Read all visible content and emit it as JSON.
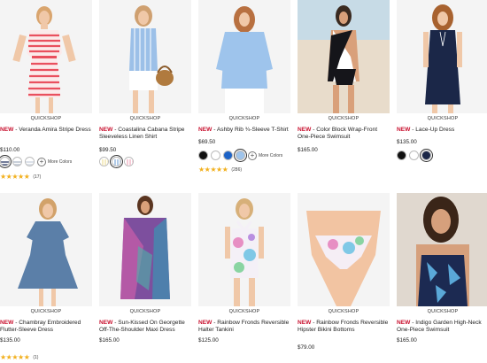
{
  "quickshop_label": "QUICKSHOP",
  "new_label": "NEW",
  "more_colors_label": "More Colors",
  "products": [
    {
      "name": "Veranda Amira Stripe Dress",
      "price": "$110.00",
      "more_colors": true,
      "rating_count": "(17)",
      "stars": 5,
      "swatches": [
        "#1e2d5c",
        "#ffffff",
        "#ffffff"
      ]
    },
    {
      "name": "Coastalina Cabana Stripe Sleeveless Linen Shirt",
      "price": "$99.50",
      "more_colors": false,
      "rating_count": "",
      "stars": 0,
      "swatches": [
        "#f1e4a8",
        "#8fb4dd",
        "#f2b5c6"
      ]
    },
    {
      "name": "Ashby Rib ¾-Sleeve T-Shirt",
      "price": "$69.50",
      "more_colors": true,
      "rating_count": "(286)",
      "stars": 5,
      "swatches": [
        "#111111",
        "#ffffff",
        "#1d63c7"
      ]
    },
    {
      "name": "Color Block Wrap-Front One-Piece Swimsuit",
      "price": "$165.00",
      "more_colors": false,
      "rating_count": "",
      "stars": 0,
      "swatches": []
    },
    {
      "name": "Lace-Up Dress",
      "price": "$135.00",
      "more_colors": false,
      "rating_count": "",
      "stars": 0,
      "swatches": [
        "#111111",
        "#ffffff",
        "#1b2748"
      ]
    },
    {
      "name": "Chambray Embroidered Flutter-Sleeve Dress",
      "price": "$135.00",
      "more_colors": false,
      "rating_count": "(1)",
      "stars": 5,
      "swatches": []
    },
    {
      "name": "Sun-Kissed On Georgette Off-The-Shoulder Maxi Dress",
      "price": "$165.00",
      "more_colors": false,
      "rating_count": "",
      "stars": 0,
      "swatches": []
    },
    {
      "name": "Rainbow Fronds Reversible Halter Tankini",
      "price": "$125.00",
      "more_colors": false,
      "rating_count": "",
      "stars": 0,
      "swatches": []
    },
    {
      "name": "Rainbow Fronds Reversible Hipster Bikini Bottoms",
      "price": "$79.00",
      "more_colors": false,
      "rating_count": "",
      "stars": 0,
      "swatches": []
    },
    {
      "name": "Indigo Garden High-Neck One-Piece Swimsuit",
      "price": "$165.00",
      "more_colors": false,
      "rating_count": "",
      "stars": 0,
      "swatches": []
    }
  ],
  "colors": {
    "new_red": "#c8102e",
    "star_gold": "#f2b01e"
  }
}
